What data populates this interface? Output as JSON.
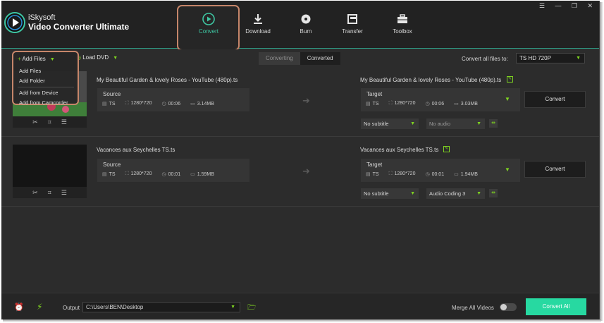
{
  "app": {
    "brand_line1": "iSkysoft",
    "brand_line2": "Video Converter Ultimate",
    "window_controls": "☰ — ❐ ✕"
  },
  "nav": {
    "tabs": [
      {
        "label": "Convert",
        "icon": "convert-icon",
        "active": true
      },
      {
        "label": "Download",
        "icon": "download-icon"
      },
      {
        "label": "Burn",
        "icon": "burn-icon"
      },
      {
        "label": "Transfer",
        "icon": "transfer-icon"
      },
      {
        "label": "Toolbox",
        "icon": "toolbox-icon"
      }
    ]
  },
  "toolbar": {
    "add_files": "Add Files",
    "load_dvd": "Load DVD",
    "seg_converting": "Converting",
    "seg_converted": "Converted",
    "convert_all_label": "Convert all files to:",
    "convert_all_value": "TS HD 720P"
  },
  "add_menu": {
    "items": [
      "Add Files",
      "Add Folder",
      "Add from Device",
      "Add from Camcorder"
    ]
  },
  "files": [
    {
      "source_name": "My Beautiful Garden & lovely Roses - YouTube (480p).ts",
      "source": {
        "title": "Source",
        "format": "TS",
        "resolution": "1280*720",
        "duration": "00:06",
        "size": "3.14MB"
      },
      "target_name": "My Beautiful Garden & lovely Roses - YouTube (480p).ts",
      "target": {
        "title": "Target",
        "format": "TS",
        "resolution": "1280*720",
        "duration": "00:06",
        "size": "3.03MB"
      },
      "convert_label": "Convert",
      "subtitle": "No subtitle",
      "audio": "No audio"
    },
    {
      "source_name": "Vacances aux Seychelles TS.ts",
      "source": {
        "title": "Source",
        "format": "TS",
        "resolution": "1280*720",
        "duration": "00:01",
        "size": "1.59MB"
      },
      "target_name": "Vacances aux Seychelles TS.ts",
      "target": {
        "title": "Target",
        "format": "TS",
        "resolution": "1280*720",
        "duration": "00:01",
        "size": "1.94MB"
      },
      "convert_label": "Convert",
      "subtitle": "No subtitle",
      "audio": "Audio Coding 3"
    }
  ],
  "footer": {
    "output_label": "Output",
    "output_path": "C:\\Users\\BEN\\Desktop",
    "merge_label": "Merge All Videos",
    "convert_all_button": "Convert All"
  },
  "colors": {
    "accent": "#27d9a1",
    "lime": "#7ed321",
    "highlight_border": "#c6866a"
  }
}
